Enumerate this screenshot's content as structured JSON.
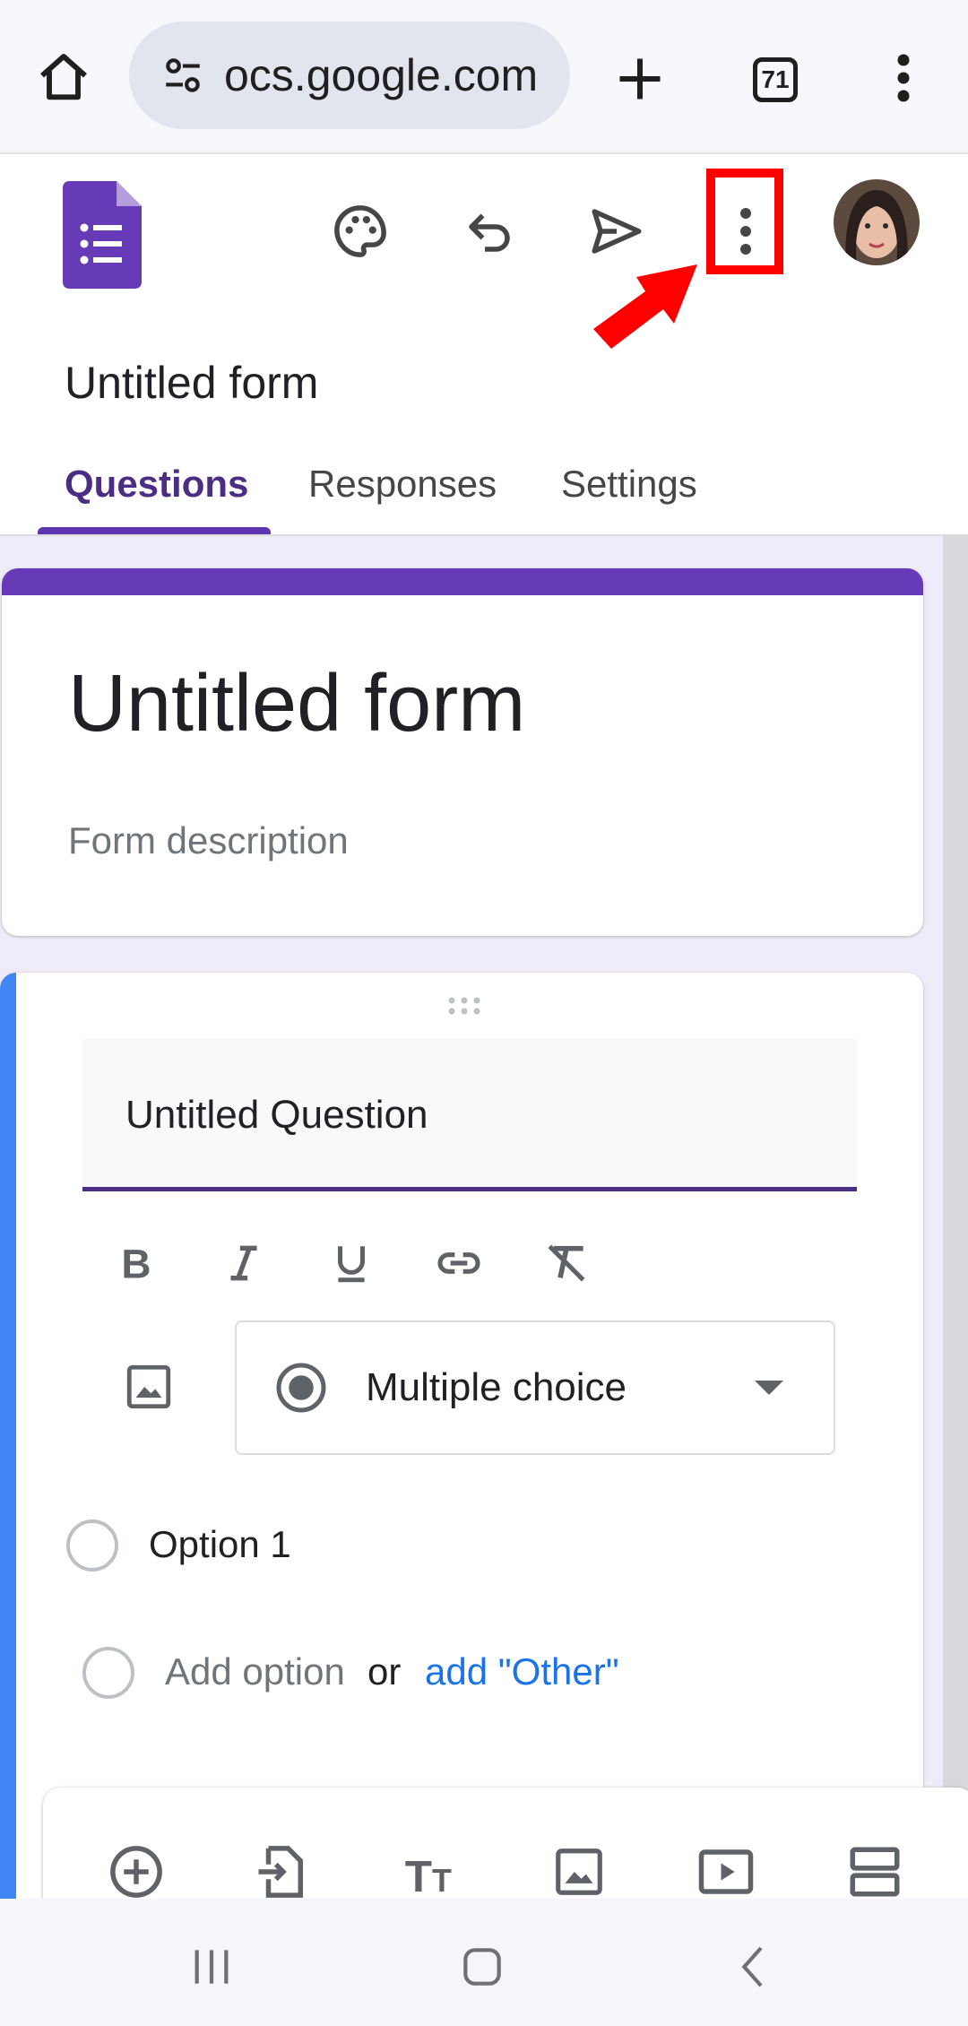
{
  "browser": {
    "url": "ocs.google.com",
    "tab_count": "71"
  },
  "forms": {
    "doc_title": "Untitled form",
    "tabs": [
      {
        "label": "Questions",
        "active": true
      },
      {
        "label": "Responses",
        "active": false
      },
      {
        "label": "Settings",
        "active": false
      }
    ],
    "header": {
      "title": "Untitled form",
      "description_placeholder": "Form description"
    },
    "question": {
      "title": "Untitled Question",
      "type": "Multiple choice",
      "options": [
        "Option 1"
      ],
      "add_option": "Add option",
      "or": "or",
      "add_other": "add \"Other\""
    }
  },
  "icons": {
    "toolbar": [
      "palette-icon",
      "undo-icon",
      "send-icon",
      "more-vert-icon"
    ],
    "formatting": [
      "bold-icon",
      "italic-icon",
      "underline-icon",
      "link-icon",
      "clear-format-icon"
    ],
    "float_toolbar": [
      "add-question-icon",
      "import-questions-icon",
      "add-title-icon",
      "add-image-icon",
      "add-video-icon",
      "add-section-icon"
    ],
    "nav": [
      "recent-apps-icon",
      "home-icon",
      "back-icon"
    ]
  },
  "colors": {
    "accent": "#673ab7",
    "question_accent": "#4285f4",
    "link": "#1a73e8",
    "highlight": "#ff0000"
  }
}
